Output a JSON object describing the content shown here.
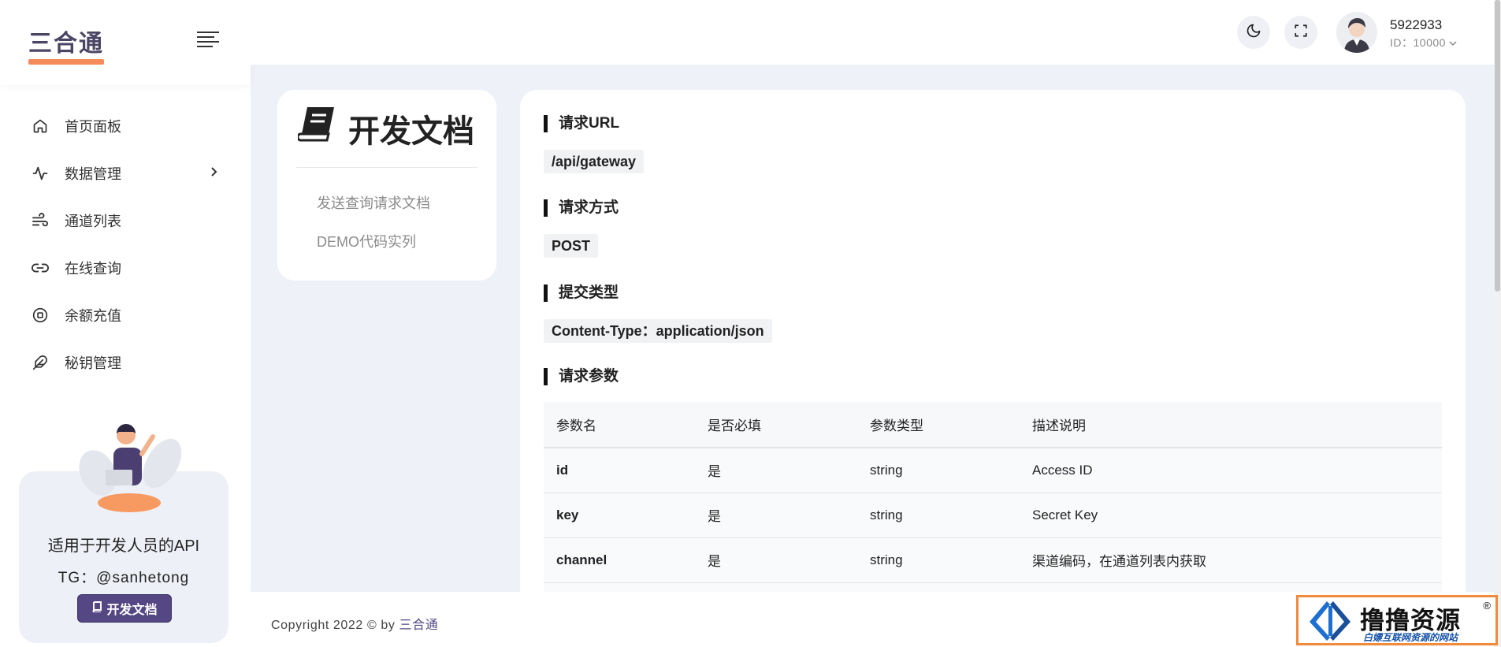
{
  "brand": {
    "logo_text": "三合通"
  },
  "sidebar": {
    "items": [
      {
        "label": "首页面板",
        "icon": "home-icon"
      },
      {
        "label": "数据管理",
        "icon": "activity-icon"
      },
      {
        "label": "通道列表",
        "icon": "wind-icon"
      },
      {
        "label": "在线查询",
        "icon": "link-icon"
      },
      {
        "label": "余额充值",
        "icon": "coin-icon"
      },
      {
        "label": "秘钥管理",
        "icon": "feather-icon"
      }
    ],
    "promo": {
      "title": "适用于开发人员的API",
      "tg": "TG：@sanhetong",
      "button_label": "开发文档"
    }
  },
  "header": {
    "username": "5922933",
    "user_id": "ID：10000"
  },
  "doc_nav": {
    "title": "开发文档",
    "links": [
      "发送查询请求文档",
      "DEMO代码实列"
    ]
  },
  "doc": {
    "url_title": "请求URL",
    "url_value": "/api/gateway",
    "method_title": "请求方式",
    "method_value": "POST",
    "content_title": "提交类型",
    "content_value": "Content-Type：application/json",
    "params_title": "请求参数",
    "table": {
      "headers": [
        "参数名",
        "是否必填",
        "参数类型",
        "描述说明"
      ],
      "rows": [
        [
          "id",
          "是",
          "string",
          "Access ID"
        ],
        [
          "key",
          "是",
          "string",
          "Secret Key"
        ],
        [
          "channel",
          "是",
          "string",
          "渠道编码，在通道列表内获取"
        ]
      ]
    }
  },
  "footer": {
    "copyright_prefix": "Copyright 2022 © by",
    "copyright_brand": "三合通"
  },
  "watermark": {
    "title": "撸撸资源",
    "registered": "®",
    "subtitle": "白嫖互联网资源的网站"
  },
  "colors": {
    "accent": "#544783",
    "logo_underline": "#f58b5b",
    "watermark_border": "#f08a3c",
    "page_bg": "#eef1f7"
  }
}
